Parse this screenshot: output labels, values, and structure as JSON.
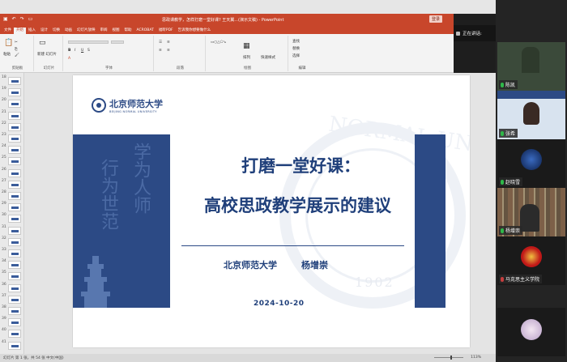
{
  "ppt": {
    "doc_title": "思政课教学，怎样打磨一堂好课? 王天翼...(演示文稿) - PowerPoint",
    "signin_label": "登录",
    "tabs": [
      "文件",
      "开始",
      "插入",
      "设计",
      "切换",
      "动画",
      "幻灯片放映",
      "审阅",
      "视图",
      "帮助",
      "ACROBAT",
      "福昕PDF",
      "告诉我你想要做什么"
    ],
    "ribbon_groups": [
      "剪贴板",
      "幻灯片",
      "字体",
      "段落",
      "绘图",
      "编辑"
    ],
    "ribbon_buttons": {
      "paste": "粘贴",
      "new_slide": "新建\n幻灯片",
      "arrange": "排列",
      "quick_styles": "快速样式",
      "find": "查找",
      "replace": "替换",
      "select": "选择"
    },
    "thumb_numbers": [
      "18",
      "19",
      "20",
      "21",
      "22",
      "23",
      "24",
      "25",
      "26",
      "27",
      "28",
      "29",
      "30",
      "31",
      "32",
      "33",
      "34",
      "35",
      "36",
      "37",
      "38",
      "39",
      "40",
      "41"
    ]
  },
  "slide": {
    "logo_cn": "北京师范大学",
    "logo_en": "BEIJING NORMAL UNIVERSITY",
    "calligraphy": [
      "学为人师",
      "行为世范"
    ],
    "title_line1": "打磨一堂好课：",
    "title_line2": "高校思政教学展示的建议",
    "affiliation": "北京师范大学",
    "author": "杨增崇",
    "date": "2024-10-20",
    "watermark": "NORMAL UNIV",
    "watermark_year": "1902"
  },
  "status": {
    "left_text": "幻灯片 第 1 张，共 54 张    中文(中国)",
    "zoom": "113%"
  },
  "meeting": {
    "speaking_label": "正在讲话:",
    "speaking_name": "张磊",
    "participants": [
      {
        "name": "陈凯",
        "mic": "on"
      },
      {
        "name": "张希",
        "mic": "on"
      },
      {
        "name": "赵晓雪",
        "mic": "on"
      },
      {
        "name": "杨增崇",
        "mic": "on"
      },
      {
        "name": "马克思主义学院",
        "mic": "off"
      },
      {
        "name": "",
        "mic": "on"
      }
    ]
  }
}
